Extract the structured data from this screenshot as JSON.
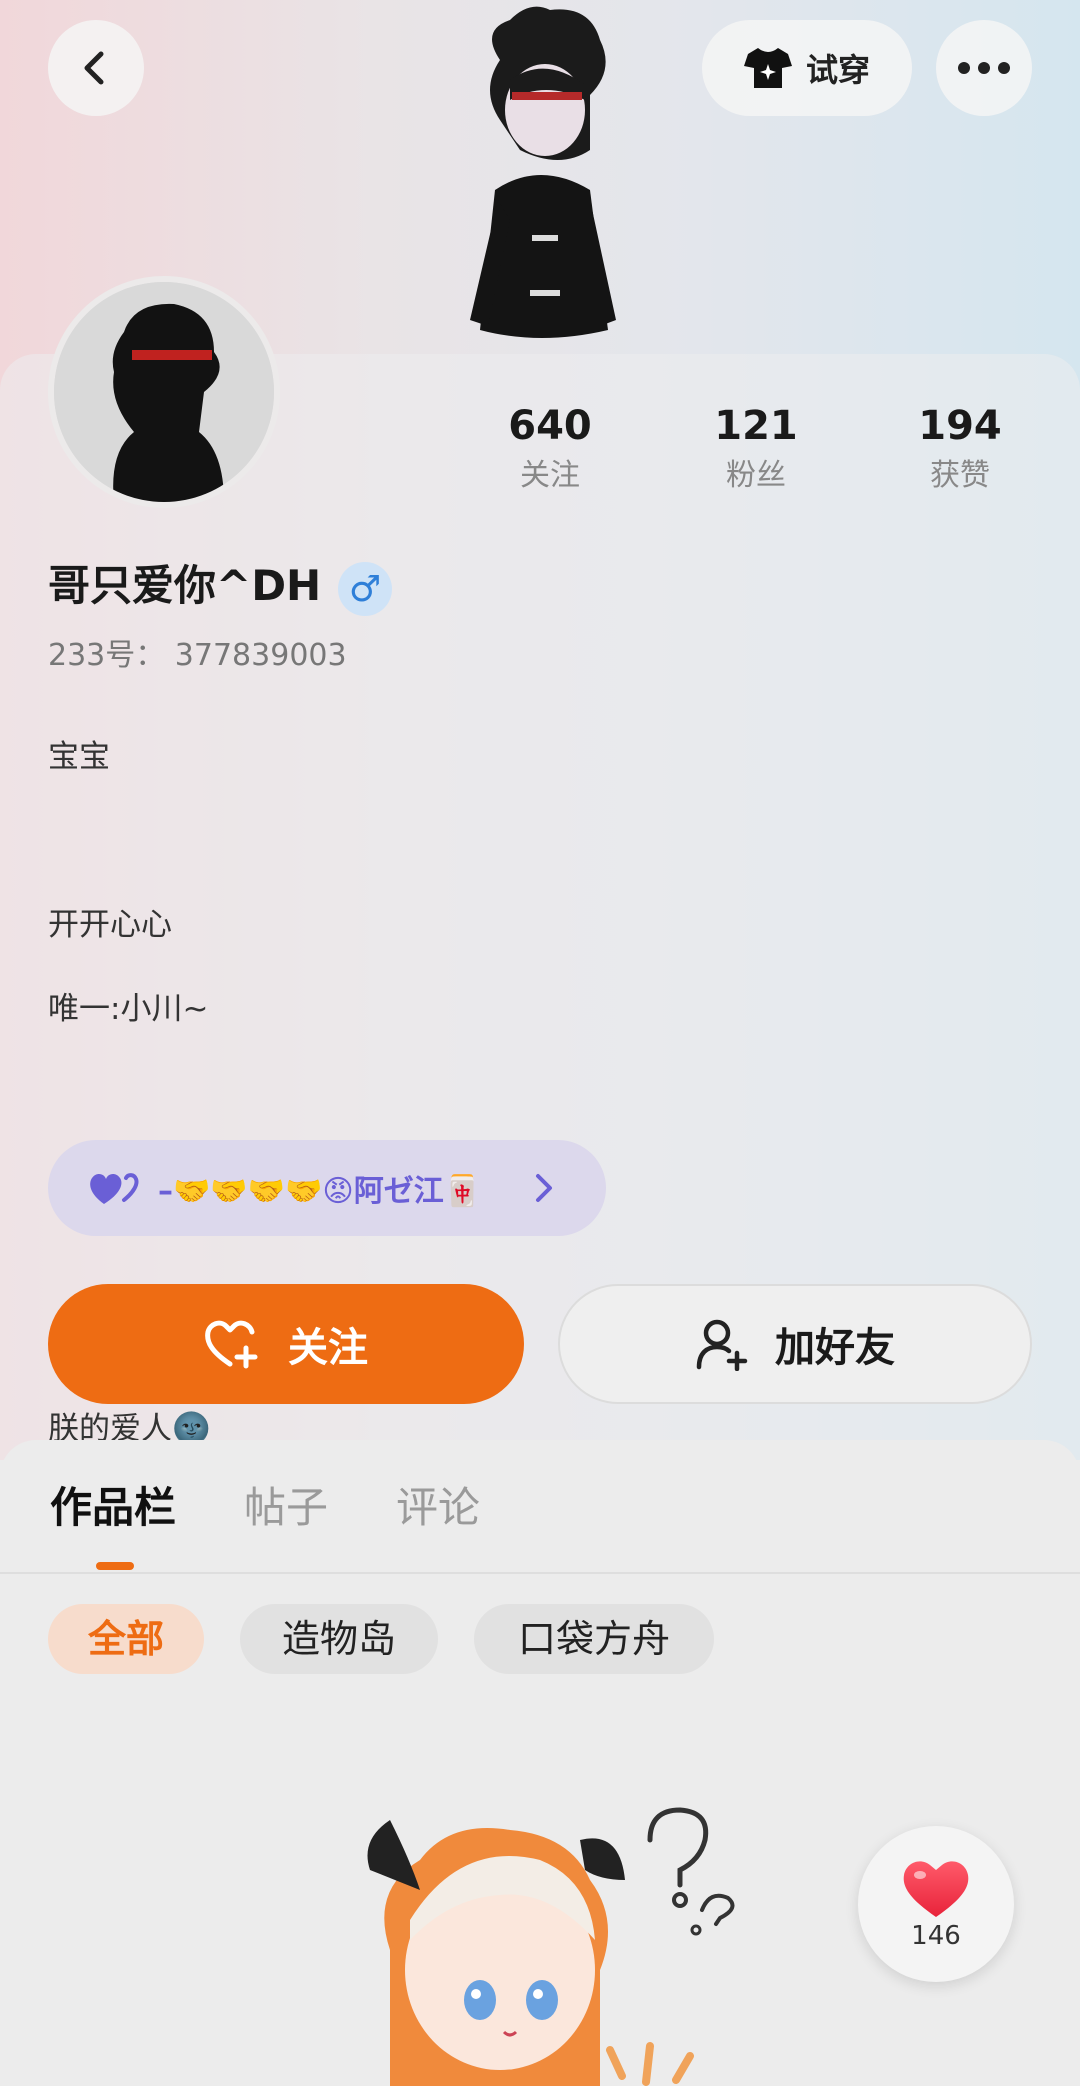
{
  "header": {
    "try_on_label": "试穿"
  },
  "profile": {
    "stats": [
      {
        "value": "640",
        "label": "关注"
      },
      {
        "value": "121",
        "label": "粉丝"
      },
      {
        "value": "194",
        "label": "获赞"
      }
    ],
    "nickname": "哥只爱你^DH",
    "gender_symbol": "♂",
    "uid_text": "233号： 377839003",
    "bio_lines": [
      "宝宝",
      "",
      "开开心心",
      "唯一:小川~",
      "",
      "",
      "",
      "",
      "朕的爱人🌚",
      "      ↓"
    ],
    "partner": {
      "name": "–🤝🤝🤝🤝😡阿ゼ江🀄"
    }
  },
  "actions": {
    "follow_label": "关注",
    "add_friend_label": "加好友"
  },
  "tabs": [
    {
      "label": "作品栏",
      "active": true
    },
    {
      "label": "帖子",
      "active": false
    },
    {
      "label": "评论",
      "active": false
    }
  ],
  "filters": [
    {
      "label": "全部",
      "active": true
    },
    {
      "label": "造物岛",
      "active": false
    },
    {
      "label": "口袋方舟",
      "active": false
    }
  ],
  "like_fab": {
    "count": "146"
  },
  "colors": {
    "accent": "#ee6c13",
    "partner_text": "#6a5fd6",
    "gender_badge": "#2f7fd8"
  }
}
